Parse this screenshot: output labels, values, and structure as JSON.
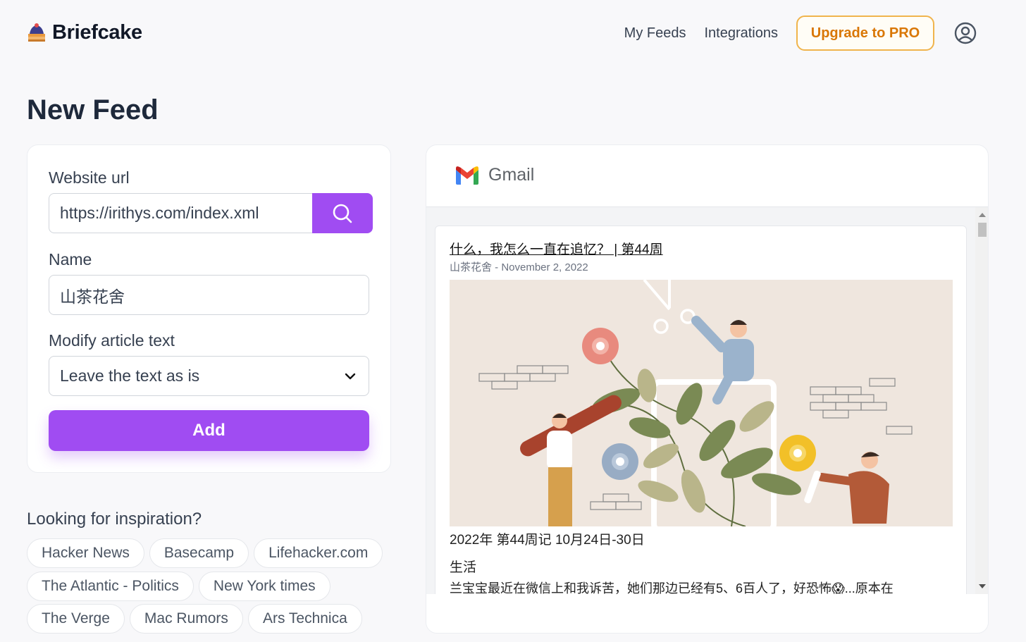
{
  "app": {
    "name": "Briefcake"
  },
  "nav": {
    "my_feeds": "My Feeds",
    "integrations": "Integrations",
    "upgrade": "Upgrade to PRO"
  },
  "page": {
    "title": "New Feed"
  },
  "form": {
    "url_label": "Website url",
    "url_value": "https://irithys.com/index.xml",
    "name_label": "Name",
    "name_value": "山茶花舍",
    "modify_label": "Modify article text",
    "modify_value": "Leave the text as is",
    "add_label": "Add"
  },
  "inspiration": {
    "title": "Looking for inspiration?",
    "chips": [
      "Hacker News",
      "Basecamp",
      "Lifehacker.com",
      "The Atlantic - Politics",
      "New York times",
      "The Verge",
      "Mac Rumors",
      "Ars Technica"
    ]
  },
  "preview": {
    "provider": "Gmail",
    "email": {
      "title": "什么，我怎么一直在追忆？ | 第44周",
      "meta": "山茶花舍 - November 2, 2022",
      "subhead": "2022年 第44周记 10月24日-30日",
      "section": "生活",
      "body": "兰宝宝最近在微信上和我诉苦，她们那边已经有5、6百人了，好恐怖😱...原本在"
    }
  },
  "colors": {
    "accent": "#a04cf2",
    "upgrade": "#d97706",
    "illustration_bg": "#efe6de"
  },
  "icons": [
    "briefcake-logo-icon",
    "search-icon",
    "chevron-down-icon",
    "account-icon",
    "gmail-icon"
  ]
}
